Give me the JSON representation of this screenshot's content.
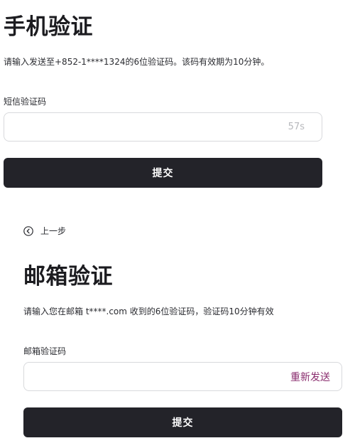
{
  "phone_section": {
    "title": "手机验证",
    "description": "请输入发送至+852-1****1324的6位验证码。该码有效期为10分钟。",
    "field_label": "短信验证码",
    "input_value": "",
    "countdown": "57s",
    "submit_label": "提交"
  },
  "back_link": {
    "label": "上一步",
    "icon": "chevron-left-circle-icon"
  },
  "email_section": {
    "title": "邮箱验证",
    "description": "请输入您在邮箱 t****.com 收到的6位验证码，验证码10分钟有效",
    "field_label": "邮箱验证码",
    "input_value": "",
    "resend_label": "重新发送",
    "submit_label": "提交"
  },
  "colors": {
    "button_background": "#232329",
    "resend_link": "#8a2d6e",
    "countdown_text": "#b7b8bc",
    "input_border": "#d8d9dc"
  }
}
